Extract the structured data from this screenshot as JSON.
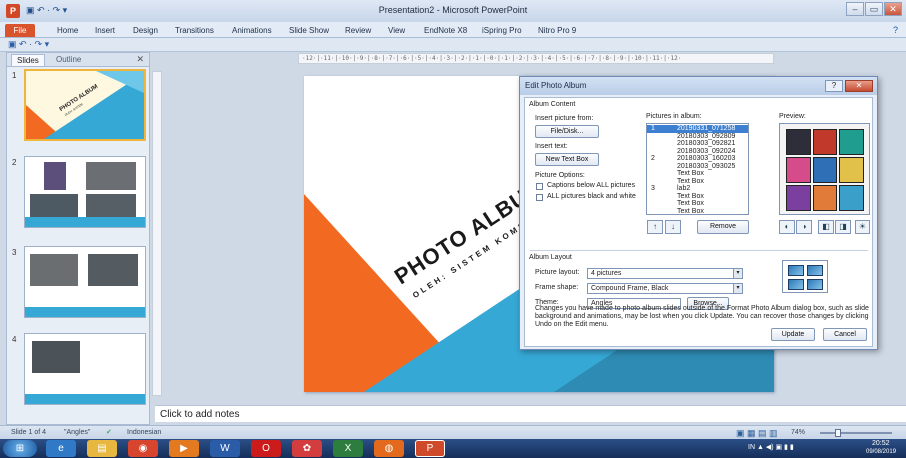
{
  "window": {
    "title": "Presentation2 - Microsoft PowerPoint",
    "app_icon": "P",
    "qat_icons": "▣ ↶ · ↷ ▾",
    "min": "–",
    "max": "▭",
    "close": "✕"
  },
  "ribbon": {
    "tabs": [
      "File",
      "Home",
      "Insert",
      "Design",
      "Transitions",
      "Animations",
      "Slide Show",
      "Review",
      "View",
      "EndNote X8",
      "iSpring Pro",
      "Nitro Pro 9"
    ],
    "help_icon": "?"
  },
  "qa_strip": {
    "icons": "▣ ↶ · ↷ ▾"
  },
  "slides_pane": {
    "tabs": [
      "Slides",
      "Outline"
    ],
    "close": "✕",
    "numbers": [
      "1",
      "2",
      "3",
      "4"
    ],
    "thumb1_title": "PHOTO ALBUM",
    "thumb1_subtitle": "OLEH: SISTEM"
  },
  "ruler": {
    "text": "·12·|·11·|·10·|·9·|·8·|·7·|·6·|·5·|·4·|·3·|·2·|·1·|·0·|·1·|·2·|·3·|·4·|·5·|·6·|·7·|·8·|·9·|·10·|·11·|·12·"
  },
  "slide": {
    "title": "PHOTO ALBUM",
    "subtitle": "OLEH: SISTEM KOMP",
    "colors": {
      "orange": "#f26a21",
      "blue": "#36a8d6",
      "light_blue": "#6ec6e8",
      "teal": "#2e8bb3"
    }
  },
  "notes": {
    "placeholder": "Click to add notes"
  },
  "status": {
    "slide": "Slide 1 of 4",
    "theme": "\"Angles\"",
    "language": "Indonesian",
    "spell_icon": "✔",
    "view_icons": "▣ ▦ ▤ ▥",
    "zoom": "74%",
    "zoom_fraction": 0.25
  },
  "taskbar": {
    "start": "⊞",
    "apps": [
      {
        "name": "ie",
        "glyph": "e",
        "color": "#2f79c6"
      },
      {
        "name": "explorer",
        "glyph": "▤",
        "color": "#e8b73f"
      },
      {
        "name": "chrome",
        "glyph": "◉",
        "color": "#d8452f"
      },
      {
        "name": "media",
        "glyph": "▶",
        "color": "#e47a1f"
      },
      {
        "name": "word",
        "glyph": "W",
        "color": "#2b5ca8"
      },
      {
        "name": "opera",
        "glyph": "O",
        "color": "#cc1b1b"
      },
      {
        "name": "app-red",
        "glyph": "✿",
        "color": "#d43d3d"
      },
      {
        "name": "excel",
        "glyph": "X",
        "color": "#2d7d3f"
      },
      {
        "name": "firefox",
        "glyph": "◍",
        "color": "#e36a1c"
      },
      {
        "name": "powerpoint",
        "glyph": "P",
        "color": "#cf4a2a"
      }
    ],
    "tray": "IN  ▲  ◀)  ▣  ▮  ▮",
    "time": "20:52",
    "date": "09/08/2019"
  },
  "dialog": {
    "title": "Edit Photo Album",
    "help": "?",
    "close": "✕",
    "album_content": "Album Content",
    "insert_picture_from": "Insert picture from:",
    "file_disk": "File/Disk...",
    "insert_text": "Insert text:",
    "new_text_box": "New Text Box",
    "picture_options": "Picture Options:",
    "captions_below": "Captions below ALL pictures",
    "all_black_white": "ALL pictures black and white",
    "pictures_in_album": "Pictures in album:",
    "list": [
      {
        "num": "1",
        "name": "20190331_071258",
        "selected": true
      },
      {
        "num": "",
        "name": "20180303_092809"
      },
      {
        "num": "",
        "name": "20180303_092821"
      },
      {
        "num": "",
        "name": "20180303_092024"
      },
      {
        "num": "2",
        "name": "20180303_160203"
      },
      {
        "num": "",
        "name": "20180303_093025"
      },
      {
        "num": "",
        "name": "Text Box"
      },
      {
        "num": "",
        "name": "Text Box"
      },
      {
        "num": "3",
        "name": "lab2"
      },
      {
        "num": "",
        "name": "Text Box"
      },
      {
        "num": "",
        "name": "Text Box"
      },
      {
        "num": "",
        "name": "Text Box"
      }
    ],
    "preview": "Preview:",
    "preview_colors": [
      "#2e2e3a",
      "#c0392b",
      "#1f9e8f",
      "#d64b8a",
      "#2f6fb5",
      "#e2c14a",
      "#7b3fa0",
      "#e07b39",
      "#3aa0c9"
    ],
    "move_up_icon": "↑",
    "move_down_icon": "↓",
    "remove": "Remove",
    "album_layout": "Album Layout",
    "picture_layout_label": "Picture layout:",
    "picture_layout_value": "4 pictures",
    "frame_shape_label": "Frame shape:",
    "frame_shape_value": "Compound Frame, Black",
    "theme_label": "Theme:",
    "theme_value": "Angles",
    "browse": "Browse...",
    "dd_arrow": "▾",
    "tools": [
      "◐",
      "◑",
      "◧",
      "◨",
      "☀",
      "☼"
    ],
    "info": "Changes you have made to photo album slides outside of the Format Photo Album dialog box, such as slide background and animations, may be lost when you click Update. You can recover those changes by clicking Undo on the Edit menu.",
    "update": "Update",
    "cancel": "Cancel"
  }
}
